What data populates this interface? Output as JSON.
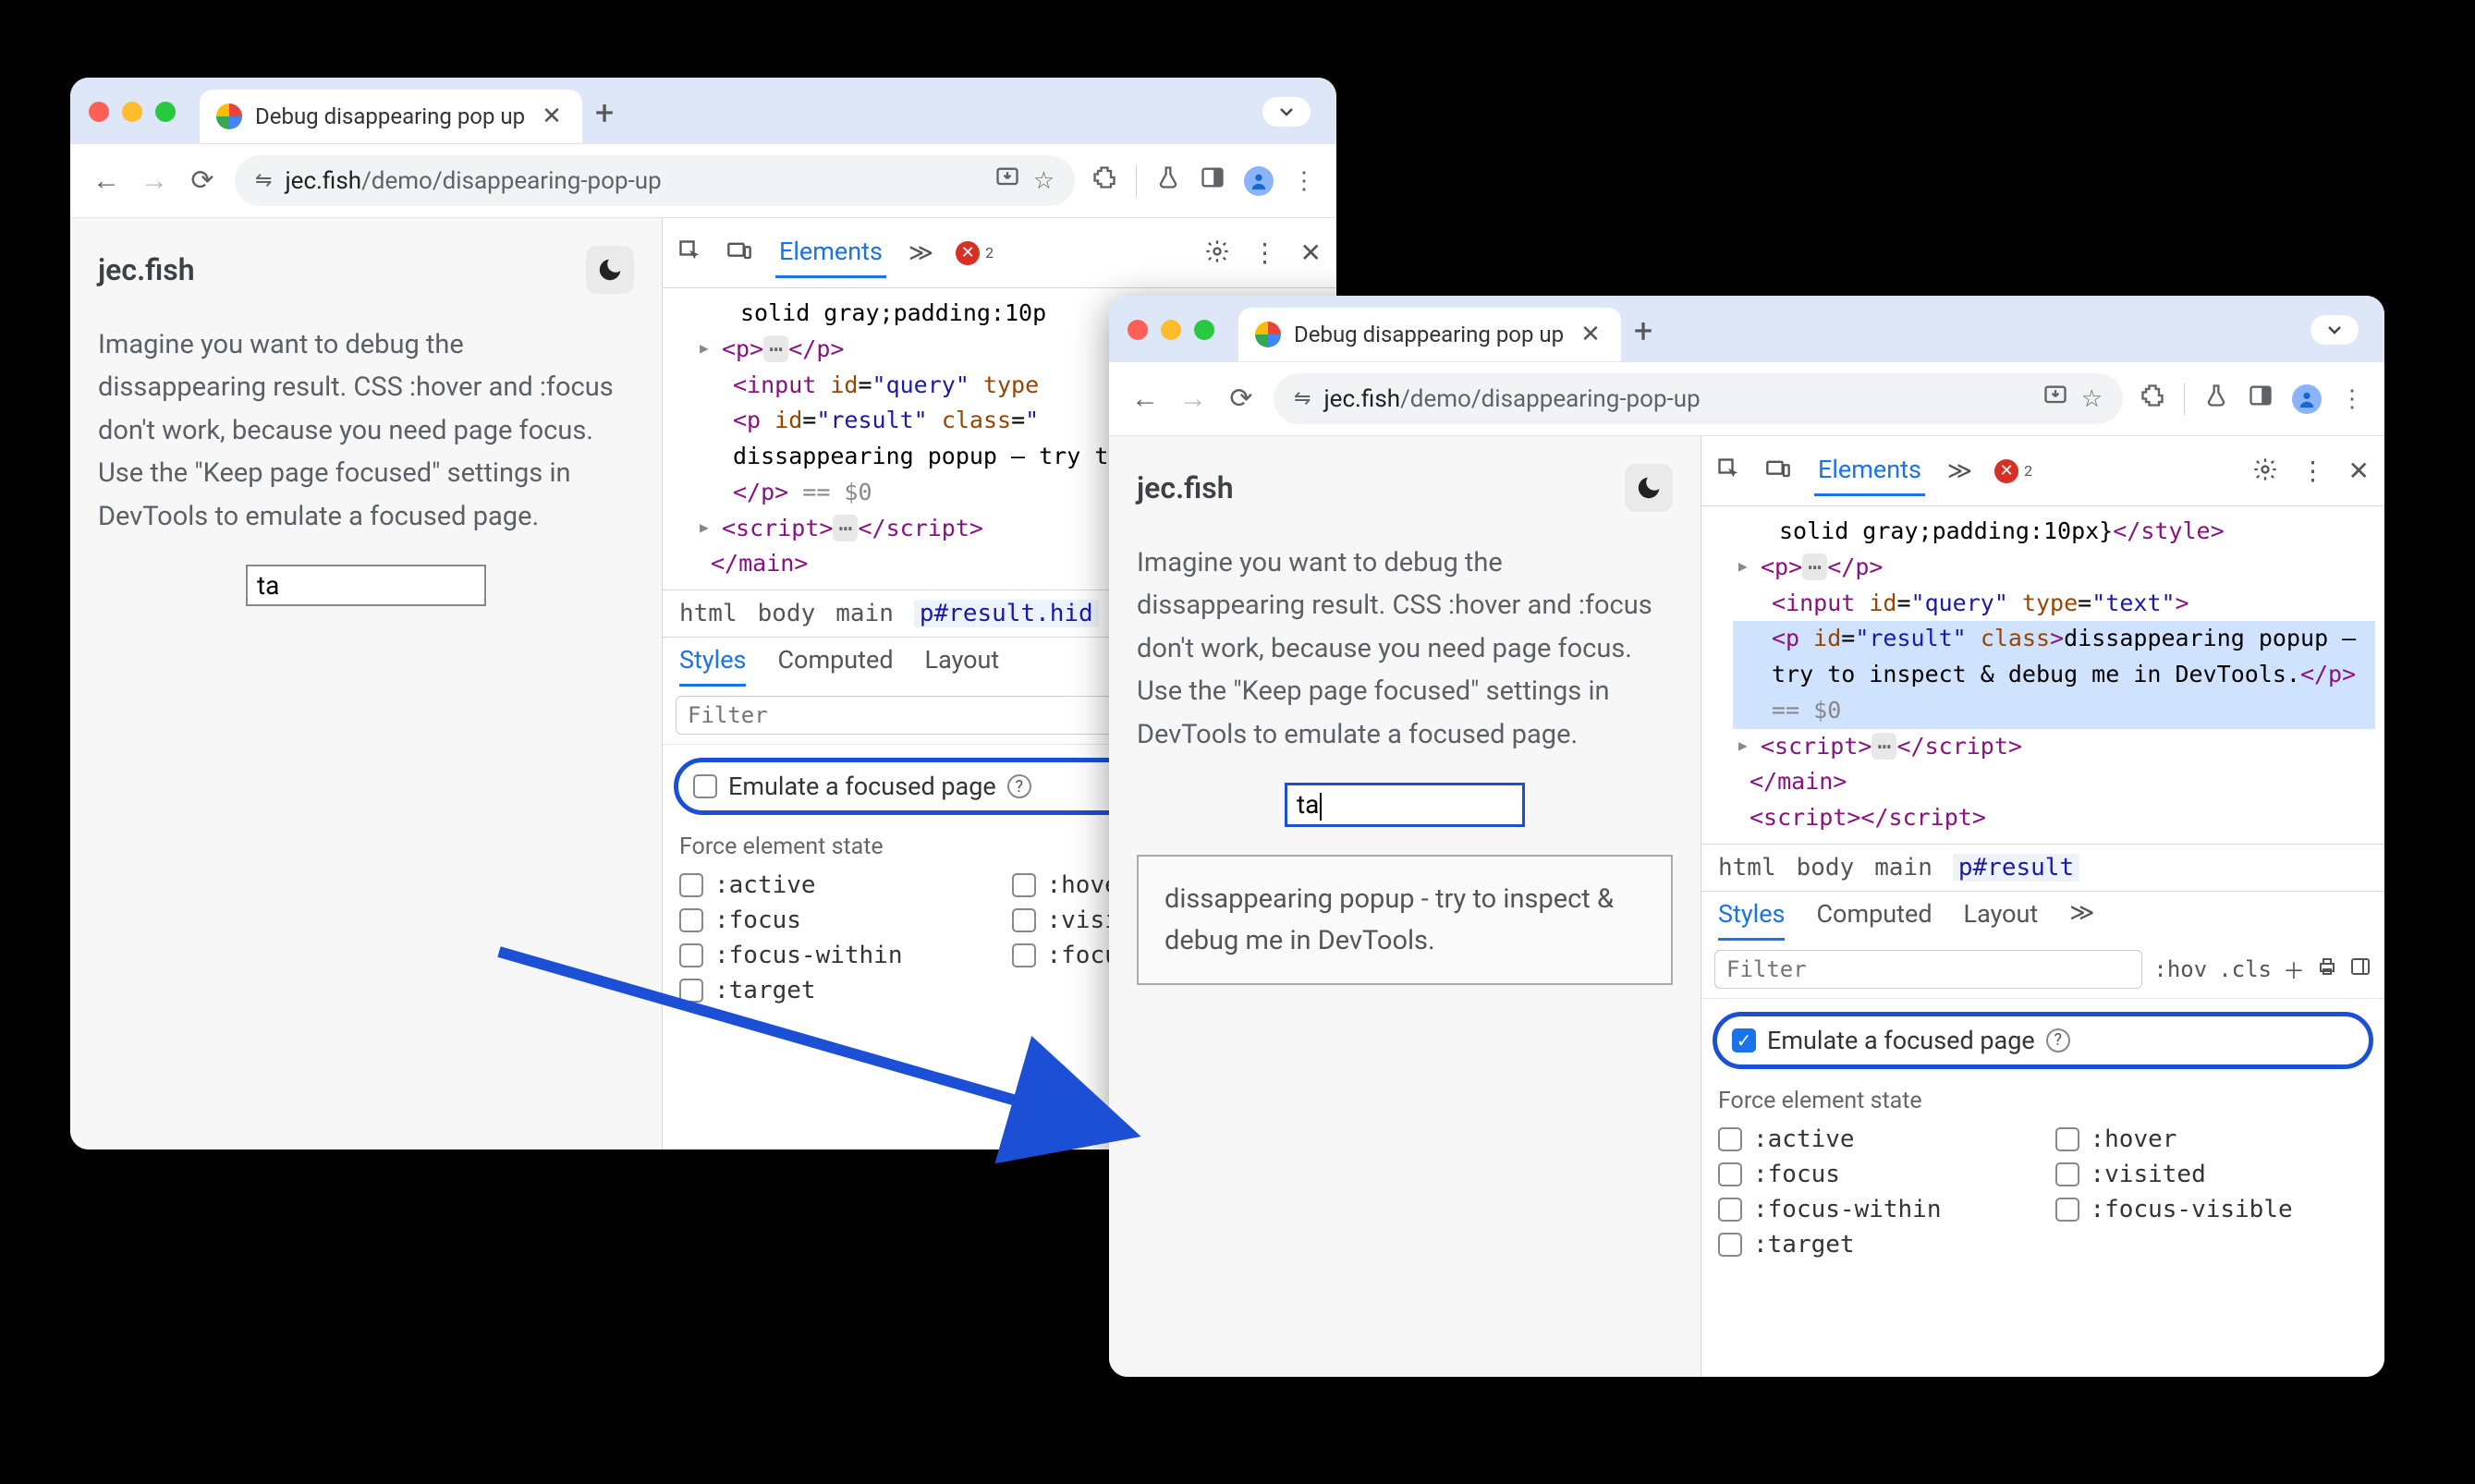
{
  "tab": {
    "title": "Debug disappearing pop up"
  },
  "url": {
    "host": "jec.fish",
    "path": "/demo/disappearing-pop-up"
  },
  "page": {
    "siteTitle": "jec.fish",
    "body": "Imagine you want to debug the dissappearing result. CSS :hover and :focus don't work, because you need page focus. Use the \"Keep page focused\" settings in DevTools to emulate a focused page.",
    "inputValue": "ta",
    "popup": "dissappearing popup - try to inspect & debug me in DevTools."
  },
  "devtools": {
    "mainTabs": {
      "elements": "Elements"
    },
    "errorCount": "2",
    "dom": {
      "styleText": "solid gray;padding:10p",
      "styleTextB": "solid gray;padding:10px}",
      "inputLine": {
        "tag": "input",
        "id": "query",
        "type": "text"
      },
      "resultLine": {
        "tag": "p",
        "id": "result",
        "classWord": "class",
        "textA": "dissappearing popup – try to inspect & debug me in",
        "textB": "dissappearing popup – try to inspect & debug me in DevTools.",
        "sig": "== $0"
      },
      "script": "script",
      "main": "main",
      "style": "style"
    },
    "breadcrumbA": [
      "html",
      "body",
      "main",
      "p#result.hid"
    ],
    "breadcrumbB": [
      "html",
      "body",
      "main",
      "p#result"
    ],
    "subtabs": {
      "styles": "Styles",
      "computed": "Computed",
      "layout": "Layout"
    },
    "filter": {
      "placeholder": "Filter",
      "hov": ":hov",
      "cls": ".cls"
    },
    "emulateLabel": "Emulate a focused page",
    "forceLabel": "Force element state",
    "states": {
      "active": ":active",
      "hover": ":hover",
      "focus": ":focus",
      "visited": ":visited",
      "focusWithin": ":focus-within",
      "focusVisible": ":focus-visible",
      "target": ":target",
      "hoverShort": ":hove",
      "visitedShort": ":visi",
      "focusShort": ":focu"
    }
  }
}
